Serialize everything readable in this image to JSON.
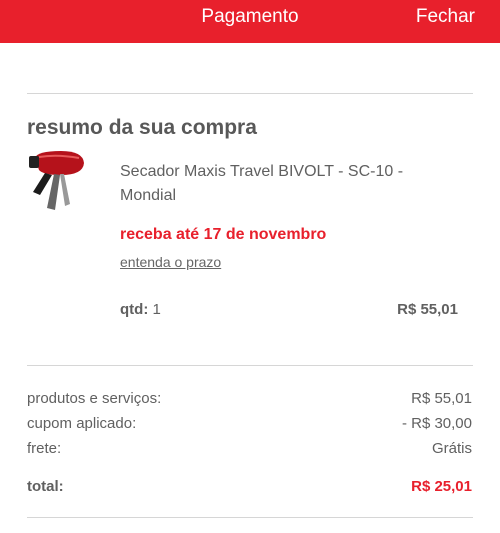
{
  "header": {
    "title": "Pagamento",
    "close_label": "Fechar",
    "color": "#e8202c"
  },
  "summary": {
    "title": "resumo da sua compra",
    "item": {
      "image_icon": "hair-dryer-icon",
      "name": "Secador Maxis Travel BIVOLT - SC-10 - Mondial",
      "delivery": "receba até 17 de novembro",
      "deadline_link": "entenda o prazo",
      "qty_label": "qtd:",
      "qty_value": "1",
      "price": "R$ 55,01"
    }
  },
  "totals": {
    "products_label": "produtos e serviços:",
    "products_value": "R$ 55,01",
    "coupon_label": "cupom aplicado:",
    "coupon_value": "- R$ 30,00",
    "shipping_label": "frete:",
    "shipping_value": "Grátis",
    "total_label": "total:",
    "total_value": "R$ 25,01"
  }
}
